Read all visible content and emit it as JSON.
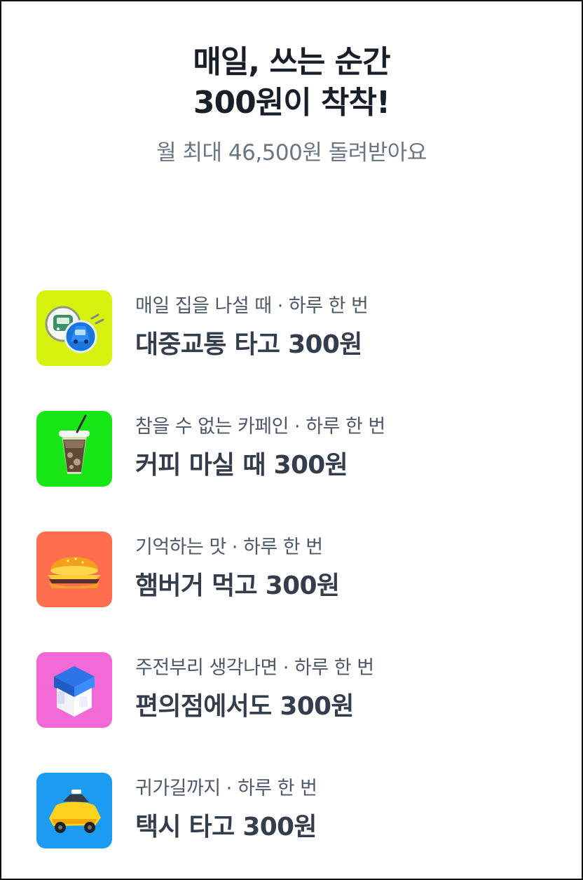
{
  "hero": {
    "title_line_1": "매일, 쓰는 순간",
    "title_line_2": "300원이 착착!",
    "subtitle": "월 최대 46,500원 돌려받아요"
  },
  "benefits": [
    {
      "caption": "매일 집을 나설 때 · 하루 한 번",
      "title": "대중교통 타고 300원",
      "icon": "bus-subway-icon",
      "tile_color": "#D7F20E"
    },
    {
      "caption": "참을 수 없는 카페인 · 하루 한 번",
      "title": "커피 마실 때 300원",
      "icon": "iced-coffee-icon",
      "tile_color": "#17E617"
    },
    {
      "caption": "기억하는 맛 · 하루 한 번",
      "title": "햄버거 먹고 300원",
      "icon": "hamburger-icon",
      "tile_color": "#FF6F4F"
    },
    {
      "caption": "주전부리 생각나면 · 하루 한 번",
      "title": "편의점에서도 300원",
      "icon": "convenience-store-icon",
      "tile_color": "#F36AD6"
    },
    {
      "caption": "귀가길까지 · 하루 한 번",
      "title": "택시 타고 300원",
      "icon": "taxi-icon",
      "tile_color": "#1D9BF0"
    }
  ]
}
